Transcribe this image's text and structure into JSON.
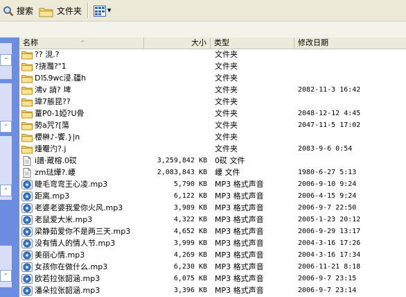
{
  "toolbar": {
    "search_label": "搜索",
    "folders_label": "文件夹",
    "search_icon": "search-icon",
    "folders_icon": "folders-icon",
    "views_icon": "views-icon"
  },
  "columns": {
    "name": "名称",
    "size": "大小",
    "type": "类型",
    "date": "修改日期",
    "sort_indicator": "^"
  },
  "files": [
    {
      "name": "??  涀.?",
      "size": "",
      "type": "文件夹",
      "date": "",
      "icon": "folder-icon"
    },
    {
      "name": "?挠灩?\"1",
      "size": "",
      "type": "文件夹",
      "date": "",
      "icon": "folder-icon"
    },
    {
      "name": "D⒖9wc浸.疆h",
      "size": "",
      "type": "文件夹",
      "date": "",
      "icon": "folder-icon"
    },
    {
      "name": "鴻v  誚?  埤",
      "size": "",
      "type": "文件夹",
      "date": "2082-11-3 16:42",
      "icon": "folder-icon"
    },
    {
      "name": "瑋7脹昆??",
      "size": "",
      "type": "文件夹",
      "date": "",
      "icon": "folder-icon"
    },
    {
      "name": "蕫P0-1婭?U骨",
      "size": "",
      "type": "文件夹",
      "date": "2048-12-12 4:45",
      "icon": "folder-icon"
    },
    {
      "name": "勢a咒?[蕩",
      "size": "",
      "type": "文件夹",
      "date": "2047-11-5 17:02",
      "icon": "folder-icon"
    },
    {
      "name": "櫻榊♪-饗.}|n",
      "size": "",
      "type": "文件夹",
      "date": "",
      "icon": "folder-icon"
    },
    {
      "name": "煄罨汋?.j",
      "size": "",
      "type": "文件夹",
      "date": "2083-9-6 0:54",
      "icon": "folder-icon"
    },
    {
      "name": "i譜·蔵榕.0砹",
      "size": "3,259,842 KB",
      "type": "0砹 文件",
      "date": "",
      "icon": "file-icon"
    },
    {
      "name": "zm琺燁?.崾",
      "size": "2,083,843 KB",
      "type": "崾 文件",
      "date": "1980-6-27 5:13",
      "icon": "file-icon"
    },
    {
      "name": "睫毛弯弯王心凌.mp3",
      "size": "5,790 KB",
      "type": "MP3 格式声音",
      "date": "2006-9-10 9:24",
      "icon": "audio-icon"
    },
    {
      "name": "距离.mp3",
      "size": "6,122 KB",
      "type": "MP3 格式声音",
      "date": "2006-4-15 9:24",
      "icon": "audio-icon"
    },
    {
      "name": "老婆老婆我爱你火风.mp3",
      "size": "3,989 KB",
      "type": "MP3 格式声音",
      "date": "2006-9-7 22:50",
      "icon": "audio-icon"
    },
    {
      "name": "老鼠爱大米.mp3",
      "size": "4,322 KB",
      "type": "MP3 格式声音",
      "date": "2005-1-23 20:12",
      "icon": "audio-icon"
    },
    {
      "name": "梁静茹爱你不是两三天.mp3",
      "size": "4,652 KB",
      "type": "MP3 格式声音",
      "date": "2006-9-29 13:17",
      "icon": "audio-icon"
    },
    {
      "name": "没有情人的情人节.mp3",
      "size": "3,999 KB",
      "type": "MP3 格式声音",
      "date": "2004-3-16 17:26",
      "icon": "audio-icon"
    },
    {
      "name": "美丽心情.mp3",
      "size": "4,269 KB",
      "type": "MP3 格式声音",
      "date": "2004-3-16 17:34",
      "icon": "audio-icon"
    },
    {
      "name": "女孩你在做什么.mp3",
      "size": "6,230 KB",
      "type": "MP3 格式声音",
      "date": "2006-11-21 8:18",
      "icon": "audio-icon"
    },
    {
      "name": "欧若拉张韶涵.mp3",
      "size": "6,075 KB",
      "type": "MP3 格式声音",
      "date": "2006-9-7 23:15",
      "icon": "audio-icon"
    },
    {
      "name": "潘朵拉张韶涵.mp3",
      "size": "3,396 KB",
      "type": "MP3 格式声音",
      "date": "2006-9-7 23:14",
      "icon": "audio-icon"
    }
  ]
}
